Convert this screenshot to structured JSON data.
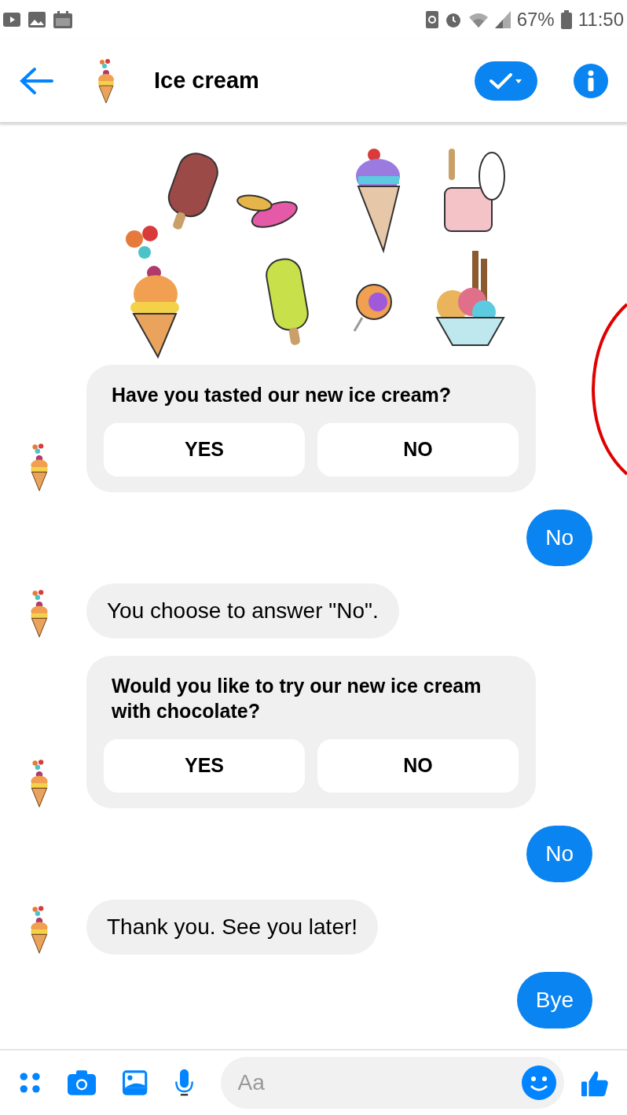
{
  "status_bar": {
    "battery": "67%",
    "time": "11:50"
  },
  "header": {
    "title": "Ice cream"
  },
  "messages": [
    {
      "kind": "card",
      "has_image": true,
      "question": "Have you tasted our new ice cream?",
      "buttons": [
        "YES",
        "NO"
      ]
    },
    {
      "kind": "outgoing",
      "text": "No"
    },
    {
      "kind": "text",
      "text": "You choose to answer \"No\"."
    },
    {
      "kind": "card",
      "has_image": false,
      "question": "Would you like to try our new ice cream with chocolate?",
      "buttons": [
        "YES",
        "NO"
      ]
    },
    {
      "kind": "outgoing",
      "text": "No"
    },
    {
      "kind": "text",
      "text": "Thank you. See you later!"
    },
    {
      "kind": "outgoing",
      "text": "Bye"
    }
  ],
  "composer": {
    "placeholder": "Aa"
  }
}
